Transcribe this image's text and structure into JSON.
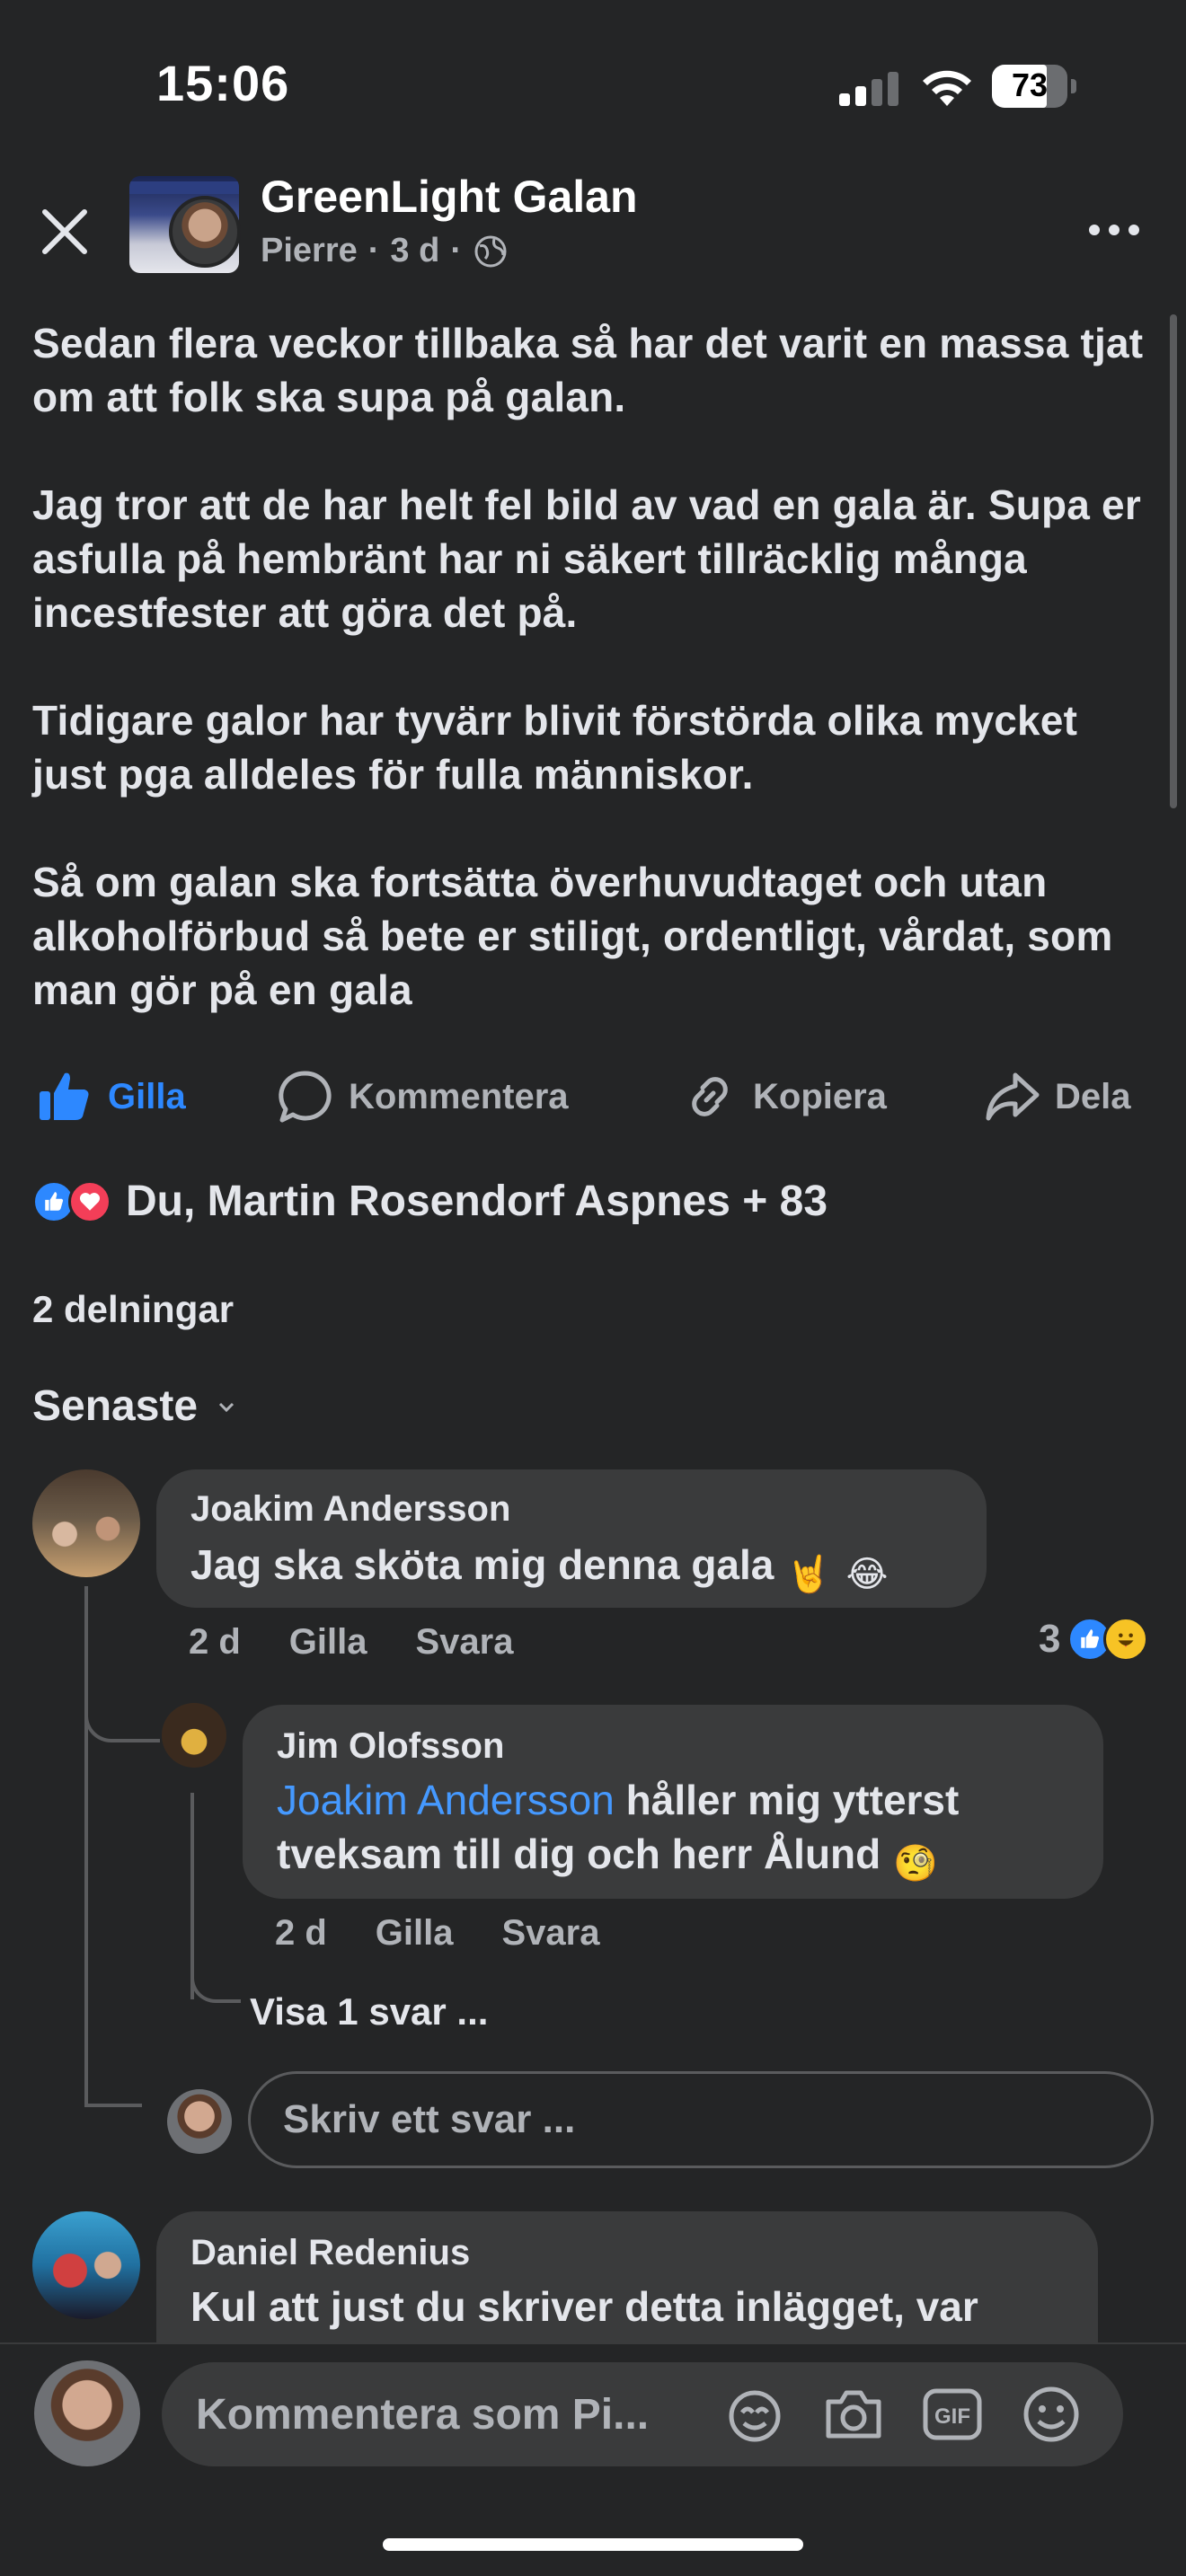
{
  "status_bar": {
    "time": "15:06",
    "battery": "73",
    "battery_level": 0.73
  },
  "header": {
    "page_name": "GreenLight Galan",
    "author": "Pierre",
    "age": "3 d"
  },
  "post": {
    "paragraphs": [
      "Sedan flera veckor tillbaka så har det varit en massa tjat om att folk ska supa på galan.",
      "Jag tror att de har helt fel bild av vad en gala är. Supa er asfulla på hembränt har ni säkert tillräcklig många incestfester att göra det på.",
      "Tidigare galor har tyvärr blivit förstörda olika mycket just pga alldeles för fulla människor.",
      "Så om galan ska fortsätta överhuvudtaget och utan alkoholförbud så bete er stiligt, ordentligt, vårdat, som man gör på en gala"
    ]
  },
  "actions": {
    "like": "Gilla",
    "comment": "Kommentera",
    "copy": "Kopiera",
    "share": "Dela"
  },
  "reactions": {
    "summary": "Du, Martin Rosendorf Aspnes + 83"
  },
  "shares": "2 delningar",
  "sort": {
    "label": "Senaste"
  },
  "comments": [
    {
      "name": "Joakim Andersson",
      "text": "Jag ska sköta mig denna gala",
      "emojis": [
        "🤘",
        "😂"
      ],
      "age": "2 d",
      "like": "Gilla",
      "reply": "Svara",
      "reaction_count": "3",
      "reply_items": [
        {
          "name": "Jim Olofsson",
          "mention": "Joakim Andersson",
          "text": "håller mig ytterst tveksam till dig och herr Ålund",
          "emoji": "🧐",
          "age": "2 d",
          "like": "Gilla",
          "reply": "Svara"
        }
      ],
      "view_more": "Visa 1 svar ...",
      "reply_placeholder": "Skriv ett svar ..."
    },
    {
      "name": "Daniel Redenius",
      "text": "Kul att just du skriver detta inlägget, var"
    }
  ],
  "composer": {
    "placeholder": "Kommentera som Pi..."
  },
  "colors": {
    "background": "#242526",
    "bubble": "#3a3b3c",
    "accent": "#2d88ff",
    "love": "#f33e58"
  },
  "icons": [
    "close-icon",
    "more-icon",
    "globe-icon",
    "like-icon",
    "comment-icon",
    "link-icon",
    "share-icon",
    "chevron-down-icon",
    "avatar-sticker-icon",
    "camera-icon",
    "gif-icon",
    "emoji-icon"
  ]
}
